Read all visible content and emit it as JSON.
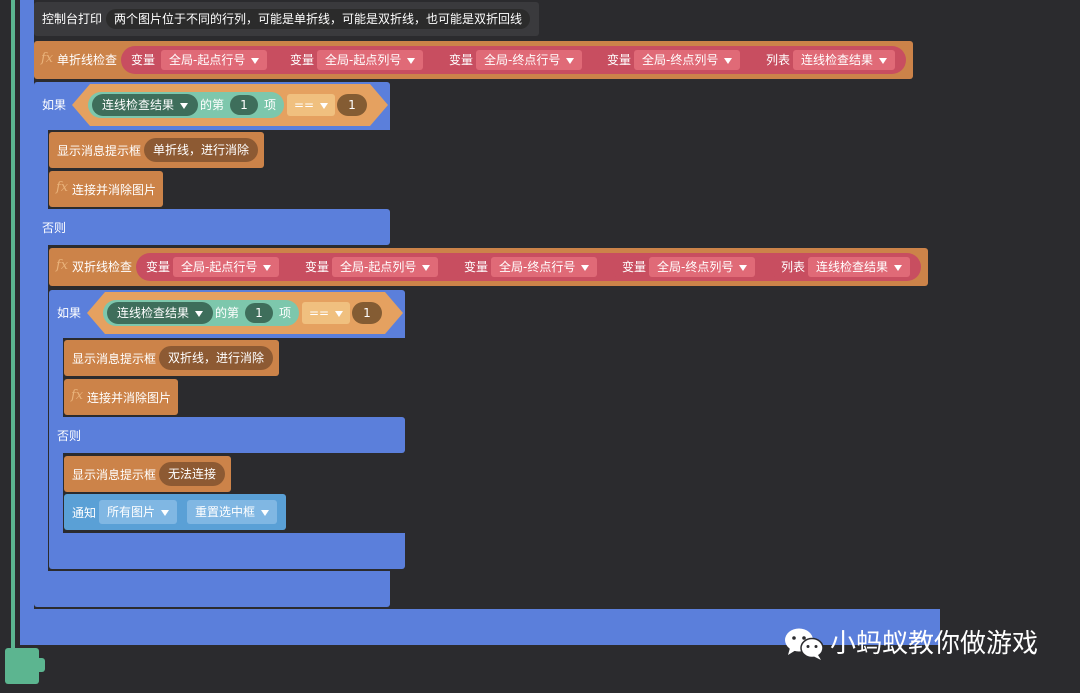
{
  "console_block": {
    "label": "控制台打印",
    "value": "两个图片位于不同的行列，可能是单折线，可能是双折线，也可能是双折回线"
  },
  "single_check": {
    "fx": "fx",
    "label": "单折线检查",
    "args": [
      {
        "kind": "变量",
        "value": "全局-起点行号"
      },
      {
        "kind": "变量",
        "value": "全局-起点列号"
      },
      {
        "kind": "变量",
        "value": "全局-终点行号"
      },
      {
        "kind": "变量",
        "value": "全局-终点列号"
      },
      {
        "kind": "列表",
        "value": "连线检查结果"
      }
    ]
  },
  "if1": {
    "label": "如果",
    "list_var": "连线检查结果",
    "of_label": "的第",
    "index": "1",
    "item_label": "项",
    "op": "==",
    "compare": "1",
    "then": [
      {
        "label": "显示消息提示框",
        "message": "单折线，进行消除"
      },
      {
        "fx": "fx",
        "label": "连接并消除图片"
      }
    ],
    "else_label": "否则"
  },
  "double_check": {
    "fx": "fx",
    "label": "双折线检查",
    "args": [
      {
        "kind": "变量",
        "value": "全局-起点行号"
      },
      {
        "kind": "变量",
        "value": "全局-起点列号"
      },
      {
        "kind": "变量",
        "value": "全局-终点行号"
      },
      {
        "kind": "变量",
        "value": "全局-终点列号"
      },
      {
        "kind": "列表",
        "value": "连线检查结果"
      }
    ]
  },
  "if2": {
    "label": "如果",
    "list_var": "连线检查结果",
    "of_label": "的第",
    "index": "1",
    "item_label": "项",
    "op": "==",
    "compare": "1",
    "then": [
      {
        "label": "显示消息提示框",
        "message": "双折线，进行消除"
      },
      {
        "fx": "fx",
        "label": "连接并消除图片"
      }
    ],
    "else_label": "否则",
    "else": [
      {
        "label": "显示消息提示框",
        "message": "无法连接"
      }
    ]
  },
  "notify": {
    "label": "通知",
    "target": "所有图片",
    "event": "重置选中框"
  },
  "watermark": {
    "text": "小蚂蚁教你做游戏",
    "icon": "wechat-icon"
  },
  "colors": {
    "background": "#2b2b2e",
    "control_blue": "#5b7fdb",
    "procedure_orange": "#cc8349",
    "variable_red": "#c84e60",
    "list_green": "#67b89a",
    "rail_green": "#5cb590",
    "notify_blue": "#5aa0d6"
  }
}
